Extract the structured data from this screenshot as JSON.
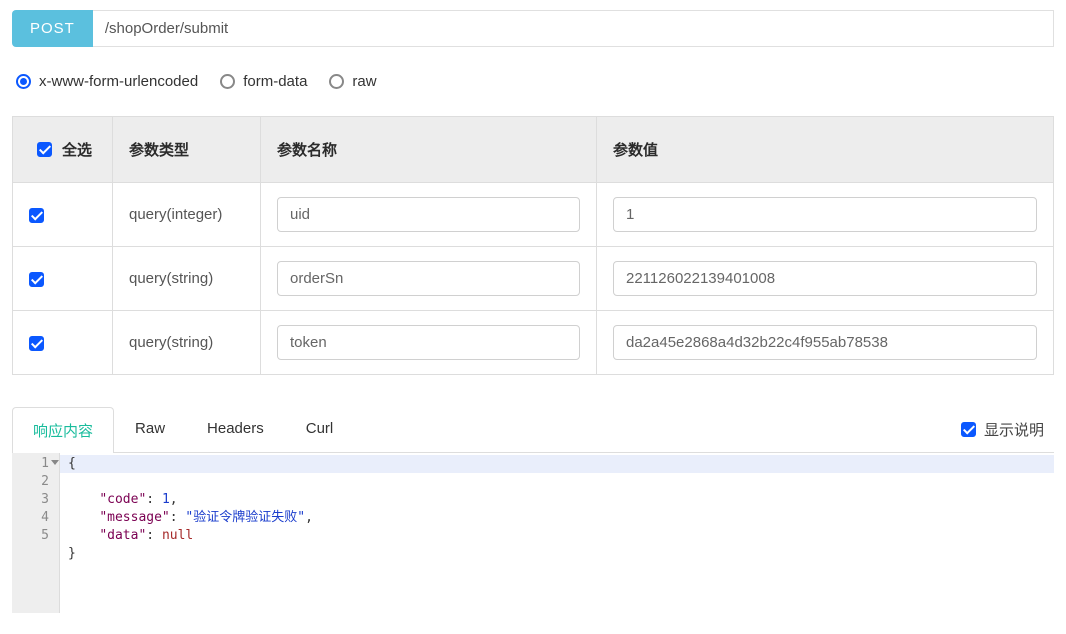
{
  "request": {
    "method": "POST",
    "url": "/shopOrder/submit"
  },
  "contentTypes": {
    "selected": 0,
    "options": [
      {
        "label": "x-www-form-urlencoded"
      },
      {
        "label": "form-data"
      },
      {
        "label": "raw"
      }
    ]
  },
  "paramsTable": {
    "headers": {
      "selectAll": "全选",
      "type": "参数类型",
      "name": "参数名称",
      "value": "参数值"
    },
    "selectAllChecked": true,
    "rows": [
      {
        "checked": true,
        "type": "query(integer)",
        "name": "uid",
        "value": "1"
      },
      {
        "checked": true,
        "type": "query(string)",
        "name": "orderSn",
        "value": "221126022139401008"
      },
      {
        "checked": true,
        "type": "query(string)",
        "name": "token",
        "value": "da2a45e2868a4d32b22c4f955ab78538"
      }
    ]
  },
  "responseTabs": {
    "active": 0,
    "items": [
      {
        "label": "响应内容"
      },
      {
        "label": "Raw"
      },
      {
        "label": "Headers"
      },
      {
        "label": "Curl"
      }
    ],
    "showDescChecked": true,
    "showDescLabel": "显示说明"
  },
  "responseBody": {
    "json": {
      "code": 1,
      "message": "验证令牌验证失败",
      "data": null
    },
    "lineCount": 5
  }
}
